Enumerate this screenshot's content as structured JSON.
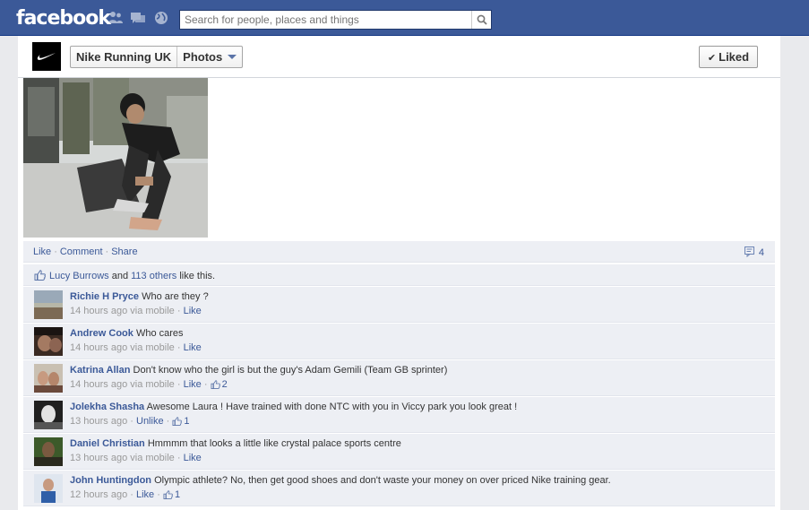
{
  "topbar": {
    "logo": "facebook",
    "search_placeholder": "Search for people, places and things",
    "jewels": [
      "friend-requests-icon",
      "messages-icon",
      "notifications-globe-icon"
    ]
  },
  "header": {
    "page_name": "Nike Running UK",
    "section": "Photos",
    "liked_label": "Liked"
  },
  "actions": {
    "like": "Like",
    "comment": "Comment",
    "share": "Share",
    "comment_count": "4"
  },
  "likes": {
    "name": "Lucy Burrows",
    "and": "and",
    "others": "113 others",
    "suffix": "like this."
  },
  "comments": [
    {
      "author": "Richie H Pryce",
      "text": "Who are they ?",
      "time": "14 hours ago",
      "via": "via mobile",
      "action": "Like",
      "like_count": ""
    },
    {
      "author": "Andrew Cook",
      "text": "Who cares",
      "time": "14 hours ago",
      "via": "via mobile",
      "action": "Like",
      "like_count": ""
    },
    {
      "author": "Katrina Allan",
      "text": "Don't know who the girl is but the guy's Adam Gemili (Team GB sprinter)",
      "time": "14 hours ago",
      "via": "via mobile",
      "action": "Like",
      "like_count": "2"
    },
    {
      "author": "Jolekha Shasha",
      "text": "Awesome Laura ! Have trained with done NTC with you in Viccy park you look great !",
      "time": "13 hours ago",
      "via": "",
      "action": "Unlike",
      "like_count": "1"
    },
    {
      "author": "Daniel Christian",
      "text": "Hmmmm that looks a little like crystal palace sports centre",
      "time": "13 hours ago",
      "via": "via mobile",
      "action": "Like",
      "like_count": ""
    },
    {
      "author": "John Huntingdon",
      "text": "Olympic athlete? No, then get good shoes and don't waste your money on over priced Nike training gear.",
      "time": "12 hours ago",
      "via": "",
      "action": "Like",
      "like_count": "1"
    }
  ],
  "colors": {
    "brand": "#3b5998",
    "link": "#3b5998",
    "feedback_bg": "#edeff4"
  }
}
